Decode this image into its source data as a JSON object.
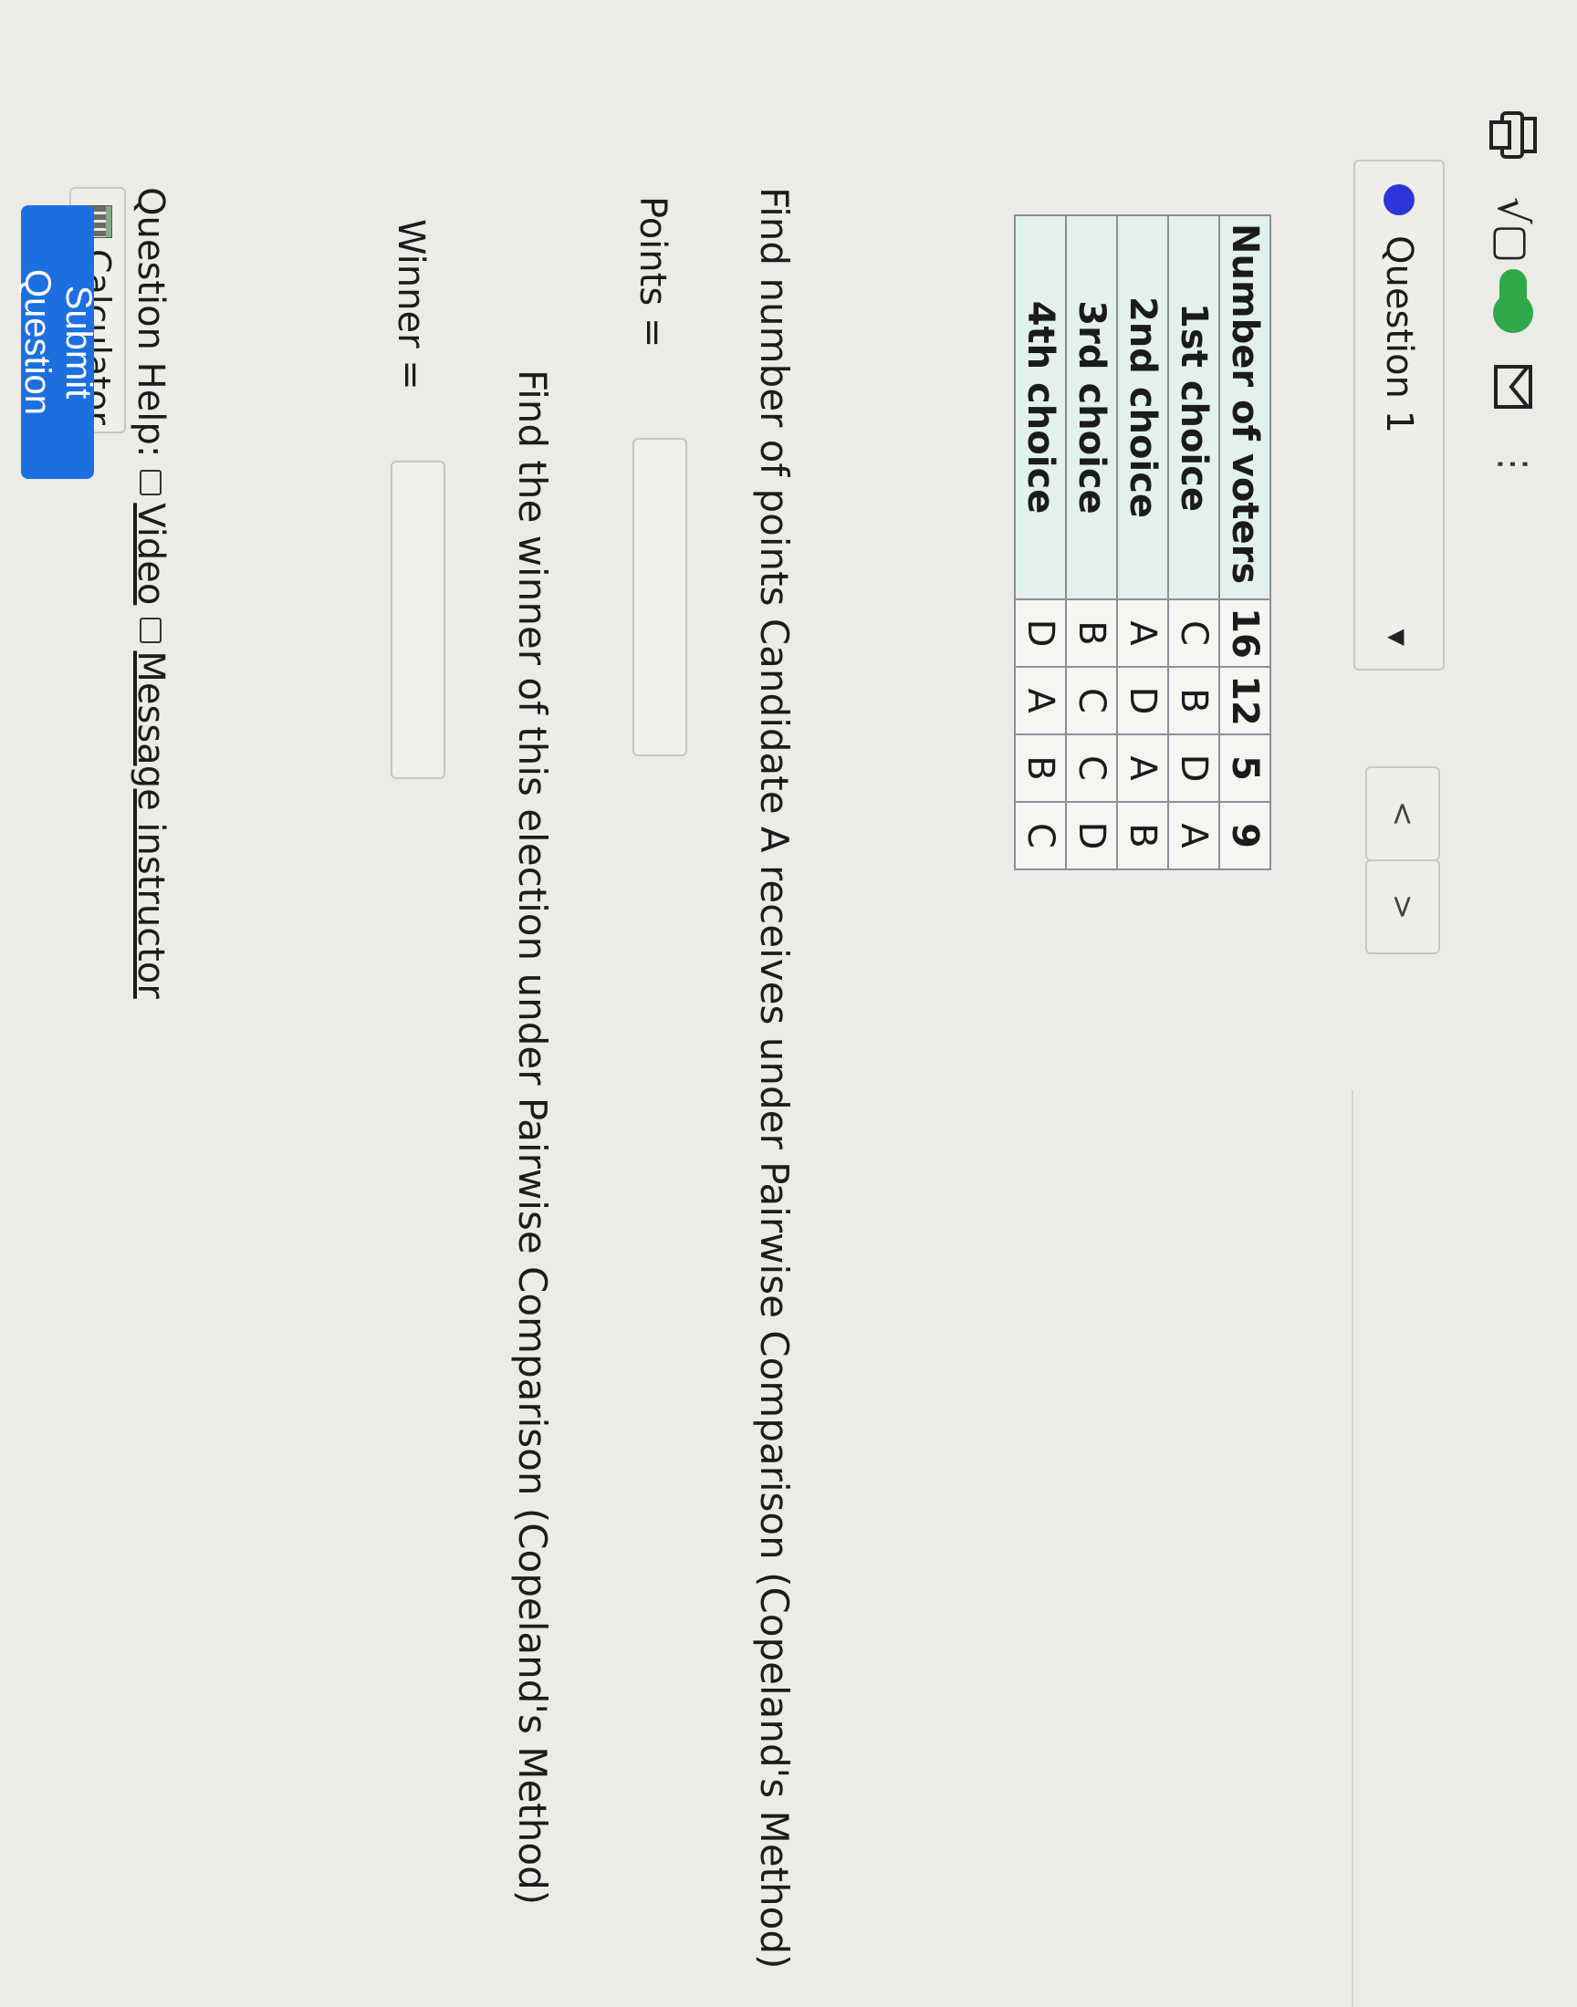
{
  "toolbar": {
    "math_icon": "sqrt-icon",
    "toggle_icon": "toggle-icon",
    "print_icon": "printer-icon",
    "message_icon": "envelope-icon",
    "more_glyph": "⋮"
  },
  "question_selector": {
    "label": "Question 1",
    "prev_glyph": "<",
    "next_glyph": ">"
  },
  "table": {
    "header_label": "Number of voters",
    "voter_counts": [
      "16",
      "12",
      "5",
      "9"
    ],
    "rows": [
      {
        "label": "1st choice",
        "values": [
          "C",
          "B",
          "D",
          "A"
        ]
      },
      {
        "label": "2nd choice",
        "values": [
          "A",
          "D",
          "A",
          "B"
        ]
      },
      {
        "label": "3rd choice",
        "values": [
          "B",
          "C",
          "C",
          "D"
        ]
      },
      {
        "label": "4th choice",
        "values": [
          "D",
          "A",
          "B",
          "C"
        ]
      }
    ]
  },
  "prompts": {
    "points_question": "Find number of points Candidate A receives under Pairwise Comparison (Copeland's Method)",
    "points_label": "Points =",
    "winner_question": "Find the winner of this election under Pairwise Comparison (Copeland's Method)",
    "winner_label": "Winner ="
  },
  "help": {
    "label": "Question Help:",
    "video_label": "Video",
    "message_label": "Message instructor",
    "calculator_label": "Calculator"
  },
  "submit": {
    "label": "Submit Question"
  },
  "colors": {
    "accent_blue": "#1d6fe0",
    "question_dot": "#2c36d6",
    "toggle_green": "#2fa84a",
    "table_header_bg": "#e3f1ed"
  }
}
